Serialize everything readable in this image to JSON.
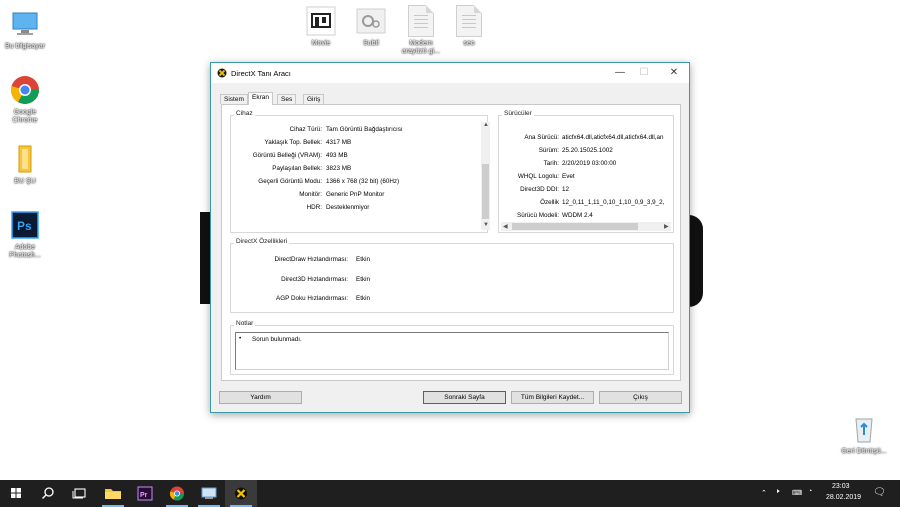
{
  "desktop": {
    "icons": [
      {
        "label": "Bu bilgisayar"
      },
      {
        "label": "Google Chrome"
      },
      {
        "label": "BU ŞU"
      },
      {
        "label": "Adobe Photosh..."
      },
      {
        "label": "Movie"
      },
      {
        "label": "Subtl"
      },
      {
        "label": "Modem arayüzü gi..."
      },
      {
        "label": "seo"
      },
      {
        "label": "Geri Dönüşü..."
      }
    ]
  },
  "window": {
    "title": "DirectX Tanı Aracı",
    "tabs": [
      "Sistem",
      "Ekran",
      "Ses",
      "Giriş"
    ],
    "active_tab": "Ekran",
    "device": {
      "group_title": "Cihaz",
      "rows": [
        {
          "label": "Cihaz Türü:",
          "value": "Tam Görüntü Bağdaştırıcısı"
        },
        {
          "label": "Yaklaşık Top. Bellek:",
          "value": "4317 MB"
        },
        {
          "label": "Görüntü Belleği (VRAM):",
          "value": "493 MB"
        },
        {
          "label": "Paylaşılan Bellek:",
          "value": "3823 MB"
        },
        {
          "label": "Geçerli Görüntü Modu:",
          "value": "1366 x 768 (32 bit) (60Hz)"
        },
        {
          "label": "Monitör:",
          "value": "Generic PnP Monitor"
        },
        {
          "label": "HDR:",
          "value": "Desteklenmiyor"
        }
      ]
    },
    "drivers": {
      "group_title": "Sürücüler",
      "rows": [
        {
          "label": "Ana Sürücü:",
          "value": "aticfx64.dll,aticfx64.dll,aticfx64.dll,an"
        },
        {
          "label": "Sürüm:",
          "value": "25.20.15025.1002"
        },
        {
          "label": "Tarih:",
          "value": "2/20/2019 03:00:00"
        },
        {
          "label": "WHQL Logolu:",
          "value": "Evet"
        },
        {
          "label": "Direct3D DDI:",
          "value": "12"
        },
        {
          "label": "Özellik",
          "value": "12_0,11_1,11_0,10_1,10_0,9_3,9_2,"
        },
        {
          "label": "Sürücü Modeli:",
          "value": "WDDM 2.4"
        }
      ]
    },
    "features": {
      "group_title": "DirectX Özellikleri",
      "rows": [
        {
          "label": "DirectDraw Hızlandırması:",
          "value": "Etkin"
        },
        {
          "label": "Direct3D Hızlandırması:",
          "value": "Etkin"
        },
        {
          "label": "AGP Doku Hızlandırması:",
          "value": "Etkin"
        }
      ]
    },
    "notes": {
      "group_title": "Notlar",
      "bullet": "•",
      "text": "Sorun bulunmadı."
    },
    "buttons": {
      "help": "Yardım",
      "next": "Sonraki Sayfa",
      "save_all": "Tüm Bilgileri Kaydet...",
      "exit": "Çıkış"
    }
  },
  "taskbar": {
    "time": "23:03",
    "date": "28.02.2019"
  },
  "colors": {
    "accent": "#0078d7",
    "window_border": "#3a9aa5",
    "taskbar": "#1f1f1f"
  }
}
